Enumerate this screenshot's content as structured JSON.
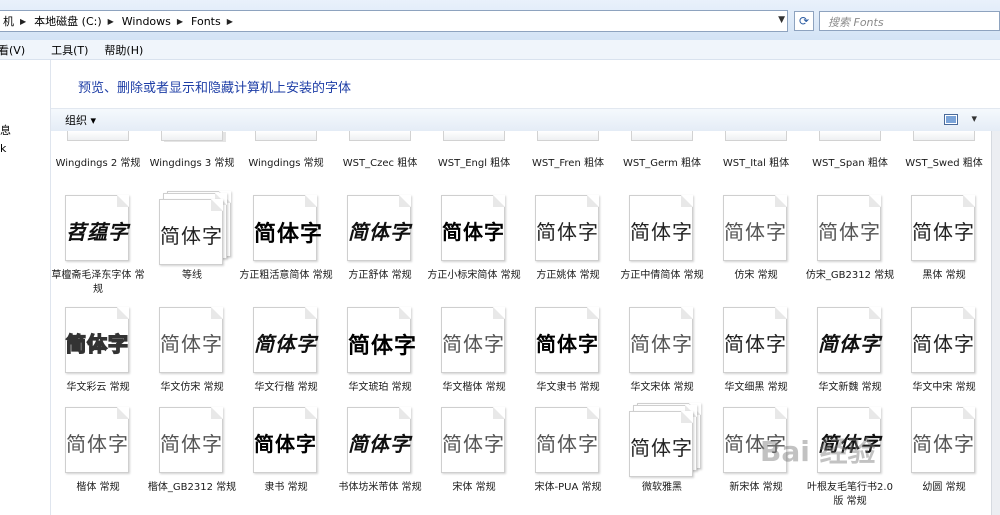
{
  "address": {
    "crumbs": [
      "机",
      "本地磁盘 (C:)",
      "Windows",
      "Fonts"
    ],
    "search_placeholder": "搜索 Fonts"
  },
  "menu": [
    "看(V)",
    "工具(T)",
    "帮助(H)"
  ],
  "leftnav": [
    "息",
    "k"
  ],
  "header": {
    "title": "预览、删除或者显示和隐藏计算机上安装的字体"
  },
  "toolbar": {
    "organize": "组织 ▾",
    "view_icon": "views-icon",
    "view_dd": "▾"
  },
  "top_row": [
    {
      "label": "Wingdings 2 常规",
      "stack": false
    },
    {
      "label": "Wingdings 3 常规",
      "stack": true
    },
    {
      "label": "Wingdings 常规",
      "stack": false
    },
    {
      "label": "WST_Czec 粗体",
      "stack": false
    },
    {
      "label": "WST_Engl 粗体",
      "stack": false
    },
    {
      "label": "WST_Fren 粗体",
      "stack": false
    },
    {
      "label": "WST_Germ 粗体",
      "stack": false
    },
    {
      "label": "WST_Ital 粗体",
      "stack": false
    },
    {
      "label": "WST_Span 粗体",
      "stack": false
    },
    {
      "label": "WST_Swed 粗体",
      "stack": false
    }
  ],
  "rows": [
    [
      {
        "sample": "苕蕴字",
        "label": "草檀斋毛泽东字体 常规",
        "style": "italic",
        "stack": false
      },
      {
        "sample": "简体字",
        "label": "等线",
        "style": "",
        "stack": true
      },
      {
        "sample": "简体字",
        "label": "方正粗活意简体 常规",
        "style": "heavy",
        "stack": false
      },
      {
        "sample": "简体字",
        "label": "方正舒体 常规",
        "style": "italic",
        "stack": false
      },
      {
        "sample": "简体字",
        "label": "方正小标宋简体 常规",
        "style": "bold",
        "stack": false
      },
      {
        "sample": "简体字",
        "label": "方正姚体 常规",
        "style": "",
        "stack": false
      },
      {
        "sample": "简体字",
        "label": "方正中倩简体 常规",
        "style": "",
        "stack": false
      },
      {
        "sample": "简体字",
        "label": "仿宋 常规",
        "style": "light",
        "stack": false
      },
      {
        "sample": "简体字",
        "label": "仿宋_GB2312 常规",
        "style": "light",
        "stack": false
      },
      {
        "sample": "简体字",
        "label": "黑体 常规",
        "style": "",
        "stack": false
      }
    ],
    [
      {
        "sample": "简体字",
        "label": "华文彩云 常规",
        "style": "outline",
        "stack": false
      },
      {
        "sample": "简体字",
        "label": "华文仿宋 常规",
        "style": "light",
        "stack": false
      },
      {
        "sample": "简体字",
        "label": "华文行楷 常规",
        "style": "italic",
        "stack": false
      },
      {
        "sample": "简体字",
        "label": "华文琥珀 常规",
        "style": "heavy",
        "stack": false
      },
      {
        "sample": "简体字",
        "label": "华文楷体 常规",
        "style": "light",
        "stack": false
      },
      {
        "sample": "简体字",
        "label": "华文隶书 常规",
        "style": "bold",
        "stack": false
      },
      {
        "sample": "简体字",
        "label": "华文宋体 常规",
        "style": "light",
        "stack": false
      },
      {
        "sample": "简体字",
        "label": "华文细黑 常规",
        "style": "",
        "stack": false
      },
      {
        "sample": "简体字",
        "label": "华文新魏 常规",
        "style": "italic",
        "stack": false
      },
      {
        "sample": "简体字",
        "label": "华文中宋 常规",
        "style": "",
        "stack": false
      }
    ],
    [
      {
        "sample": "简体字",
        "label": "楷体 常规",
        "style": "light",
        "stack": false
      },
      {
        "sample": "简体字",
        "label": "楷体_GB2312 常规",
        "style": "light",
        "stack": false
      },
      {
        "sample": "简体字",
        "label": "隶书 常规",
        "style": "bold",
        "stack": false
      },
      {
        "sample": "简体字",
        "label": "书体坊米芾体 常规",
        "style": "italic",
        "stack": false
      },
      {
        "sample": "简体字",
        "label": "宋体 常规",
        "style": "light",
        "stack": false
      },
      {
        "sample": "简体字",
        "label": "宋体-PUA 常规",
        "style": "light",
        "stack": false
      },
      {
        "sample": "简体字",
        "label": "微软雅黑",
        "style": "",
        "stack": true
      },
      {
        "sample": "简体字",
        "label": "新宋体 常规",
        "style": "light",
        "stack": false
      },
      {
        "sample": "简体字",
        "label": "叶根友毛笔行书2.0版 常规",
        "style": "italic",
        "stack": false
      },
      {
        "sample": "简体字",
        "label": "幼圆 常规",
        "style": "light",
        "stack": false
      }
    ]
  ],
  "watermark": "Bai 经验",
  "colors": {
    "title": "#1e3ea6",
    "toolbar": "#e4ecf6"
  }
}
